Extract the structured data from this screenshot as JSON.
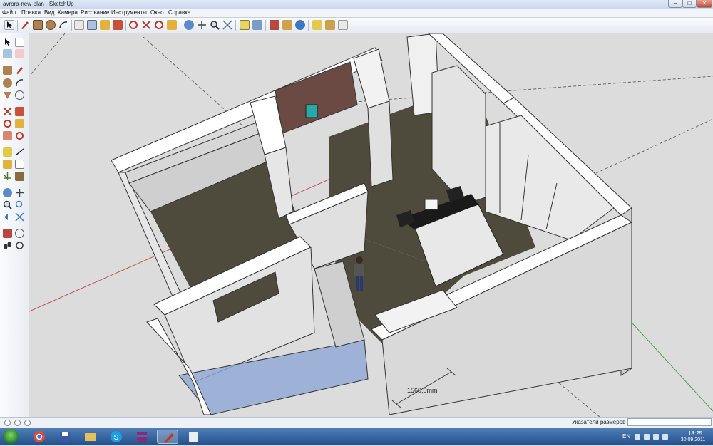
{
  "window": {
    "title": "avrora-new-plan - SketchUp"
  },
  "menu": {
    "items": [
      {
        "label": "Файл"
      },
      {
        "label": "Правка"
      },
      {
        "label": "Вид"
      },
      {
        "label": "Камера"
      },
      {
        "label": "Рисование"
      },
      {
        "label": "Инструменты"
      },
      {
        "label": "Окно"
      },
      {
        "label": "Справка"
      }
    ]
  },
  "toolbar": {
    "icons": [
      "select-icon",
      "pencil-icon",
      "rectangle-icon",
      "circle-icon",
      "arc-icon",
      "eraser-icon",
      "paint-bucket-icon",
      "push-pull-icon",
      "move-icon",
      "rotate-icon",
      "follow-me-icon",
      "offset-icon",
      "orbit-icon",
      "pan-icon",
      "zoom-icon",
      "zoom-extents-icon",
      "tape-measure-icon",
      "section-icon",
      "walk-icon",
      "position-camera-icon",
      "look-around-icon",
      "components-icon",
      "materials-icon",
      "styles-icon"
    ]
  },
  "viewport": {
    "dimension_label": "1560,0mm",
    "scene_colors": {
      "floor": "#4f4b3c",
      "wall_top": "#ffffff",
      "wall_side": "#d7d7d7",
      "brick": "#6b4a43",
      "glass": "#8fa8d6",
      "background": "#dcdcdc"
    }
  },
  "status": {
    "measurement_label": "Указатели размеров",
    "measurement_value": ""
  },
  "taskbar": {
    "apps": [
      "chrome-icon",
      "save-icon",
      "explorer-icon",
      "skype-icon",
      "winrar-icon",
      "sketchup-icon",
      "notepad-icon"
    ],
    "language": "EN",
    "time": "18:25",
    "date": "30.09.2011"
  }
}
